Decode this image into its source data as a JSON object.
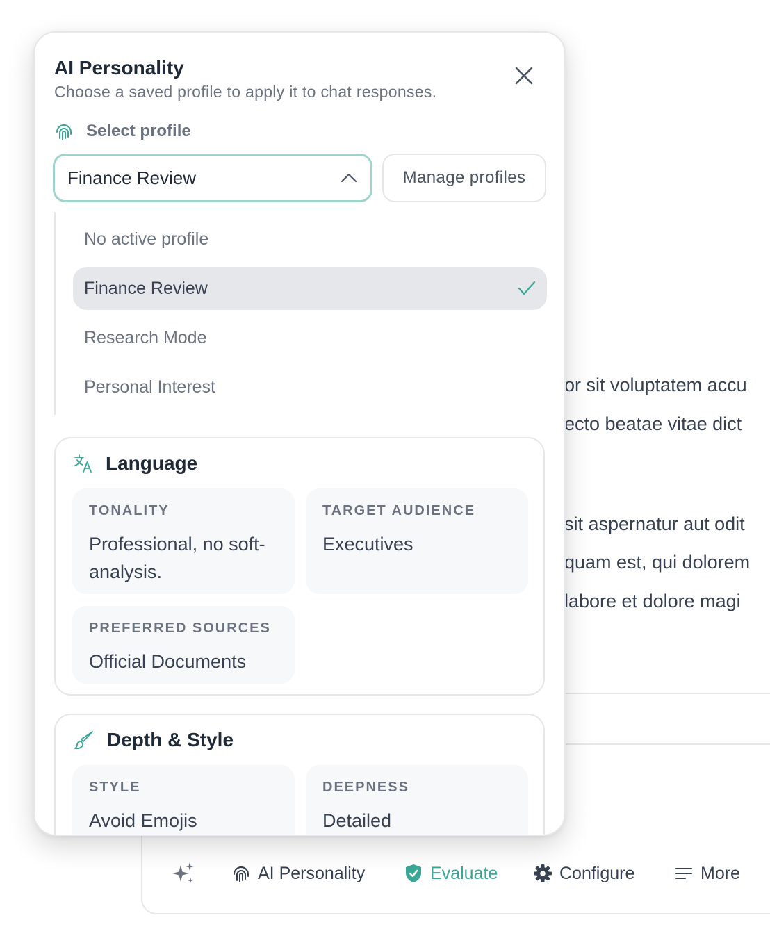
{
  "background": {
    "text_lines": [
      "or sit voluptatem accu",
      "ecto beatae vitae dict",
      "sit aspernatur aut odit",
      "quam est, qui dolorem",
      " labore et dolore magi"
    ]
  },
  "toolbar": {
    "sparkle_icon": "sparkles-icon",
    "items": [
      {
        "label": "AI Personality",
        "icon": "fingerprint-icon"
      },
      {
        "label": "Evaluate",
        "icon": "shield-check-icon",
        "color": "#3aa796"
      },
      {
        "label": "Configure",
        "icon": "gear-icon"
      },
      {
        "label": "More",
        "icon": "menu-icon"
      }
    ]
  },
  "panel": {
    "title": "AI Personality",
    "subtitle": "Choose a saved profile to apply it to chat responses.",
    "select_label": "Select profile",
    "selected_value": "Finance Review",
    "manage_label": "Manage profiles",
    "accent_color": "#3aa796",
    "options": [
      {
        "label": "No active profile",
        "active": false
      },
      {
        "label": "Finance Review",
        "active": true
      },
      {
        "label": "Research Mode",
        "active": false
      },
      {
        "label": "Personal Interest",
        "active": false
      }
    ],
    "language": {
      "title": "Language",
      "tonality_label": "TONALITY",
      "tonality_value": "Professional, no soft-analysis.",
      "audience_label": "TARGET AUDIENCE",
      "audience_value": "Executives",
      "sources_label": "PREFERRED SOURCES",
      "sources_value": "Official Documents"
    },
    "depth_style": {
      "title": "Depth & Style",
      "style_label": "STYLE",
      "style_value": "Avoid Emojis",
      "deepness_label": "DEEPNESS",
      "deepness_value": "Detailed"
    }
  }
}
